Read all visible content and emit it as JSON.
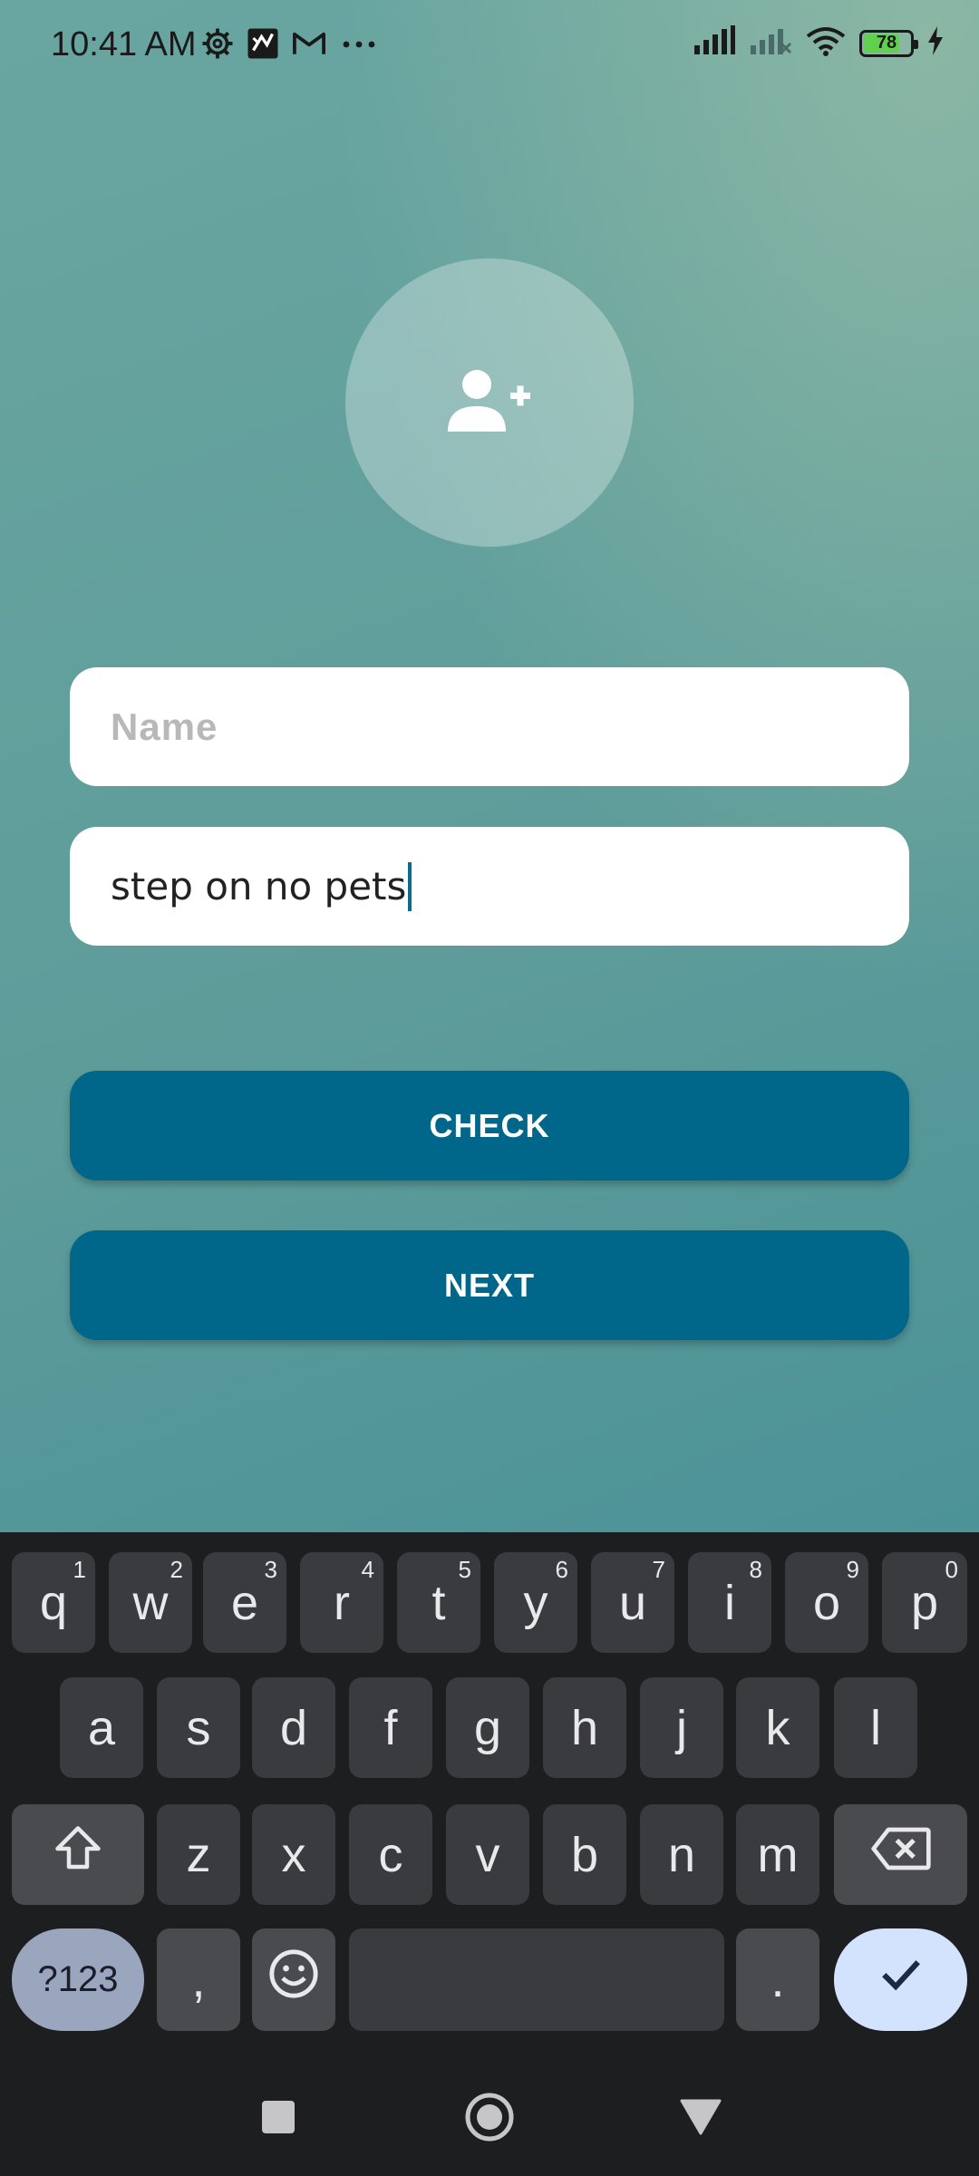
{
  "status_bar": {
    "time": "10:41 AM",
    "left_icons": [
      "settings-gear-icon",
      "app-notification-icon",
      "gmail-icon",
      "more-dots-icon"
    ],
    "right_icons": [
      "signal-icon",
      "signal-no-service-icon",
      "wifi-icon",
      "battery-icon",
      "charging-icon"
    ],
    "battery_level": "78",
    "battery_percent": 78
  },
  "avatar": {
    "icon": "add-person-icon"
  },
  "form": {
    "name_placeholder": "Name",
    "text_value": "step on no pets"
  },
  "buttons": {
    "check_label": "CHECK",
    "next_label": "NEXT"
  },
  "keyboard": {
    "row1": [
      {
        "key": "q",
        "sup": "1"
      },
      {
        "key": "w",
        "sup": "2"
      },
      {
        "key": "e",
        "sup": "3"
      },
      {
        "key": "r",
        "sup": "4"
      },
      {
        "key": "t",
        "sup": "5"
      },
      {
        "key": "y",
        "sup": "6"
      },
      {
        "key": "u",
        "sup": "7"
      },
      {
        "key": "i",
        "sup": "8"
      },
      {
        "key": "o",
        "sup": "9"
      },
      {
        "key": "p",
        "sup": "0"
      }
    ],
    "row2": [
      "a",
      "s",
      "d",
      "f",
      "g",
      "h",
      "j",
      "k",
      "l"
    ],
    "row3": [
      "z",
      "x",
      "c",
      "v",
      "b",
      "n",
      "m"
    ],
    "symbols_label": "?123",
    "comma_label": ",",
    "period_label": "."
  },
  "colors": {
    "accent": "#00678a",
    "keyboard_bg": "#1d1e20",
    "key_bg": "#3a3b3e",
    "enter_key_bg": "#d3e3fd"
  }
}
